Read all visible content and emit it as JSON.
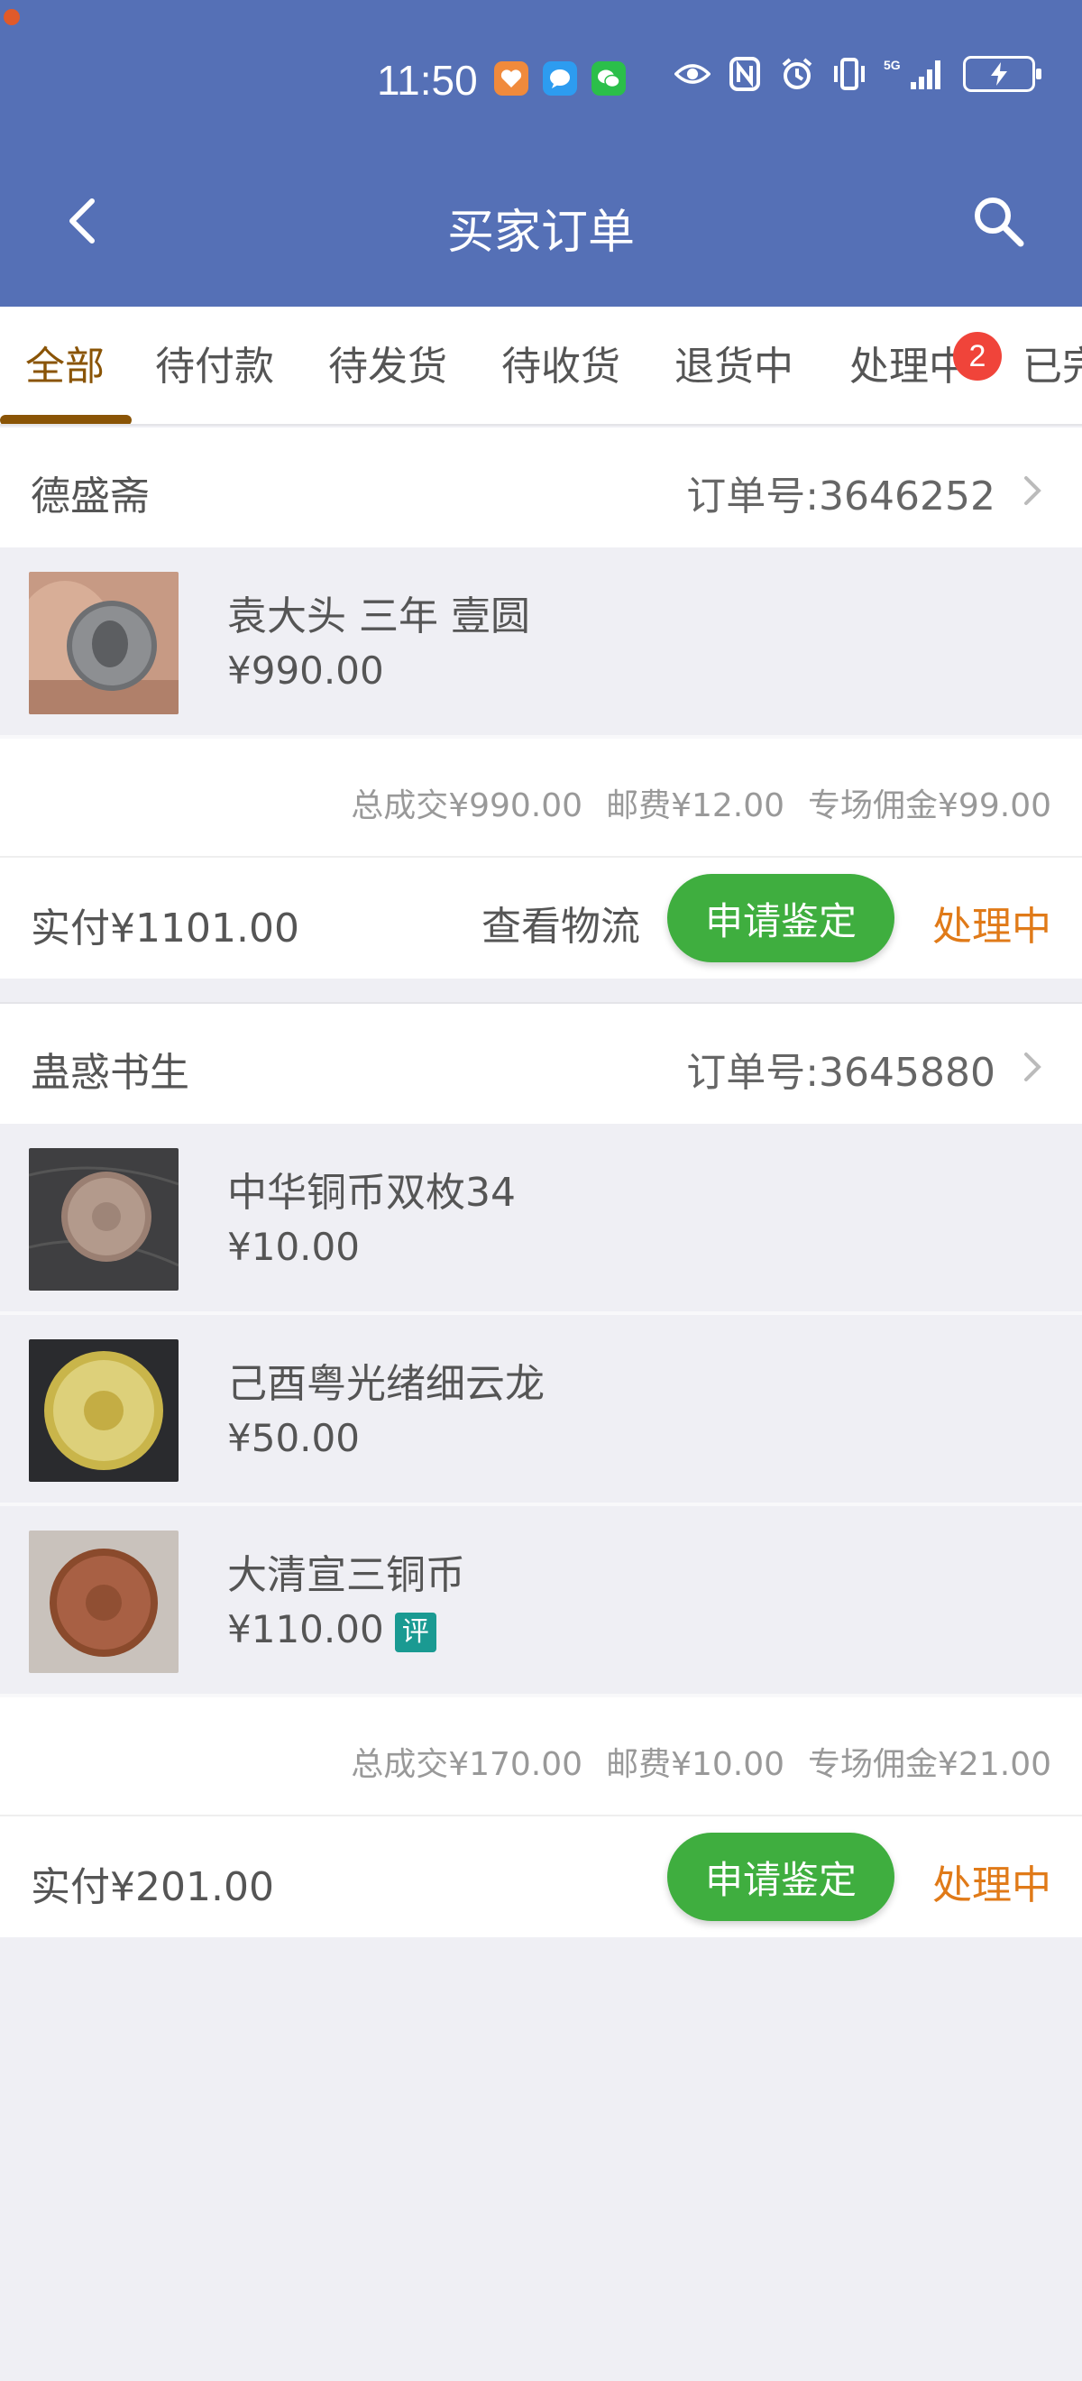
{
  "colors": {
    "header_bg": "#5570b6",
    "active_tab": "#8a5406",
    "badge": "#f0443a",
    "appraise_button": "#3fae3f",
    "processing_status": "#e07a18",
    "ping_tag": "#1a9a92"
  },
  "status_bar": {
    "time": "11:50",
    "app_icons": [
      "health-app-icon",
      "message-app-icon",
      "wechat-icon"
    ],
    "system_icons": [
      "eye-icon",
      "nfc-icon",
      "alarm-icon",
      "vibrate-icon",
      "signal-5g-icon",
      "battery-charging-icon"
    ]
  },
  "header": {
    "title": "买家订单",
    "back_icon": "back-arrow-icon",
    "search_icon": "search-icon"
  },
  "tabs": {
    "items": [
      {
        "label": "全部",
        "active": true
      },
      {
        "label": "待付款"
      },
      {
        "label": "待发货"
      },
      {
        "label": "待收货"
      },
      {
        "label": "退货中"
      },
      {
        "label": "处理中",
        "badge": "2"
      },
      {
        "label": "已完"
      }
    ]
  },
  "orders": [
    {
      "shop": "德盛斋",
      "order_no": "订单号:3646252",
      "items": [
        {
          "name": "袁大头 三年 壹圆",
          "price": "¥990.00"
        }
      ],
      "summary": {
        "total": "总成交¥990.00",
        "shipping": "邮费¥12.00",
        "commission": "专场佣金¥99.00"
      },
      "paid": "实付¥1101.00",
      "logistics_label": "查看物流",
      "appraise_label": "申请鉴定",
      "status": "处理中"
    },
    {
      "shop": "蛊惑书生",
      "order_no": "订单号:3645880",
      "items": [
        {
          "name": "中华铜币双枚34",
          "price": "¥10.00"
        },
        {
          "name": "己酉粤光绪细云龙",
          "price": "¥50.00"
        },
        {
          "name": "大清宣三铜币",
          "price": "¥110.00",
          "tag": "评"
        }
      ],
      "summary": {
        "total": "总成交¥170.00",
        "shipping": "邮费¥10.00",
        "commission": "专场佣金¥21.00"
      },
      "paid": "实付¥201.00",
      "appraise_label": "申请鉴定",
      "status": "处理中"
    }
  ]
}
